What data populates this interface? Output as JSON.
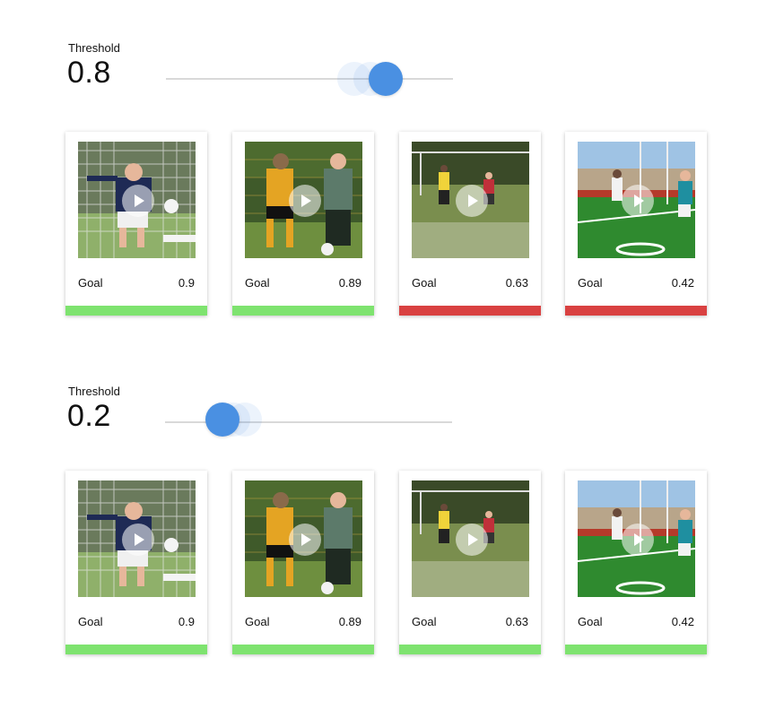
{
  "colors": {
    "pass": "#7ee36f",
    "fail": "#d94141",
    "accent": "#4a90e2"
  },
  "panels": [
    {
      "threshold_label": "Threshold",
      "threshold_value": "0.8",
      "slider_level": 0.8,
      "cards": [
        {
          "label": "Goal",
          "score": "0.9",
          "status": "pass"
        },
        {
          "label": "Goal",
          "score": "0.89",
          "status": "pass"
        },
        {
          "label": "Goal",
          "score": "0.63",
          "status": "fail"
        },
        {
          "label": "Goal",
          "score": "0.42",
          "status": "fail"
        }
      ]
    },
    {
      "threshold_label": "Threshold",
      "threshold_value": "0.2",
      "slider_level": 0.2,
      "cards": [
        {
          "label": "Goal",
          "score": "0.9",
          "status": "pass"
        },
        {
          "label": "Goal",
          "score": "0.89",
          "status": "pass"
        },
        {
          "label": "Goal",
          "score": "0.63",
          "status": "pass"
        },
        {
          "label": "Goal",
          "score": "0.42",
          "status": "pass"
        }
      ]
    }
  ]
}
